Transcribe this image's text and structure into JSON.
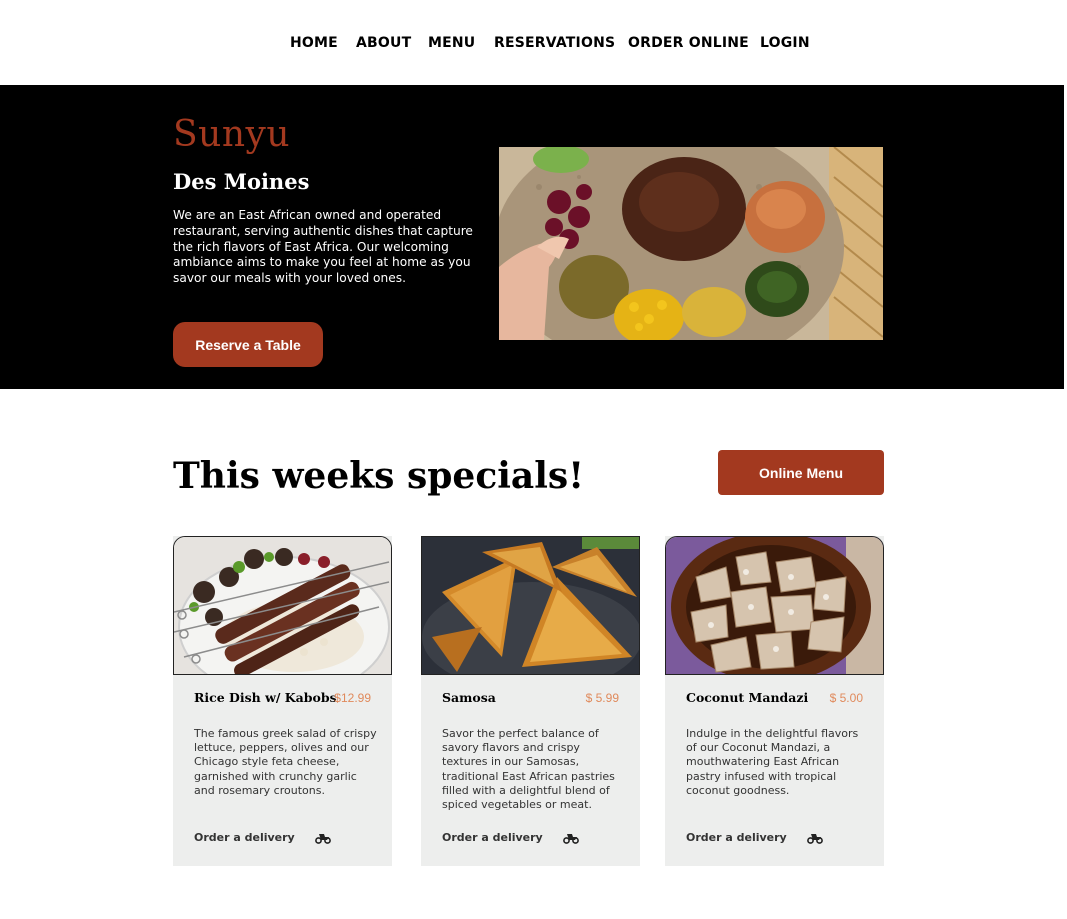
{
  "nav": {
    "items": [
      "HOME",
      "ABOUT",
      "MENU",
      "RESERVATIONS",
      "ORDER ONLINE",
      "LOGIN"
    ]
  },
  "hero": {
    "name": "Sunyu",
    "city": "Des Moines",
    "description": "We are an East African owned and operated restaurant, serving authentic dishes that capture the rich flavors of East Africa. Our welcoming ambiance aims to make you feel at home as you savor our  meals with your loved ones.",
    "reserve_label": "Reserve a Table"
  },
  "specials": {
    "title": "This weeks specials!",
    "online_menu_label": "Online Menu",
    "cards": [
      {
        "title": "Rice Dish w/ Kabobs",
        "price": "$12.99",
        "description": "The famous greek salad of crispy lettuce, peppers, olives and our Chicago style feta cheese, garnished with crunchy garlic and rosemary croutons.",
        "order_label": "Order a delivery"
      },
      {
        "title": "Samosa",
        "price": "$ 5.99",
        "description": "Savor the perfect balance of savory flavors and crispy textures in our Samosas, traditional East African pastries filled with a delightful blend of spiced vegetables or meat.",
        "order_label": "Order a delivery"
      },
      {
        "title": "Coconut Mandazi",
        "price": "$ 5.00",
        "description": "Indulge in the delightful flavors of our Coconut Mandazi, a mouthwatering East African pastry infused with tropical coconut goodness.",
        "order_label": "Order a delivery"
      }
    ]
  },
  "colors": {
    "brand": "#a3391f",
    "price": "#e08a5c",
    "card_bg": "#edeeed",
    "hero_bg": "#000000"
  },
  "icons": {
    "delivery": "motorcycle-icon"
  }
}
